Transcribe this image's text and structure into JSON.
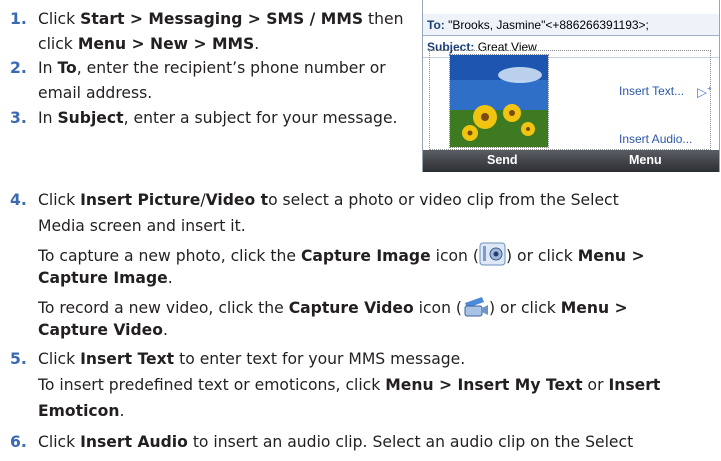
{
  "steps": [
    {
      "num": "1.",
      "lines": [
        [
          [
            "Click ",
            false
          ],
          [
            "Start > Messaging > SMS / MMS",
            true
          ],
          [
            " then",
            false
          ]
        ],
        [
          [
            "click ",
            false
          ],
          [
            "Menu > New > MMS",
            true
          ],
          [
            ".",
            false
          ]
        ]
      ]
    },
    {
      "num": "2.",
      "lines": [
        [
          [
            "In ",
            false
          ],
          [
            "To",
            true
          ],
          [
            ", enter the recipient’s phone number or",
            false
          ]
        ],
        [
          [
            "email address.",
            false
          ]
        ]
      ]
    },
    {
      "num": "3.",
      "lines": [
        [
          [
            "In ",
            false
          ],
          [
            "Subject",
            true
          ],
          [
            ", enter a subject for your message.",
            false
          ]
        ]
      ]
    },
    {
      "num": "4.",
      "lines": [
        [
          [
            "Click ",
            false
          ],
          [
            "Insert Picture",
            true
          ],
          [
            "/",
            false
          ],
          [
            "Video t",
            true
          ],
          [
            "o select a photo or video clip from the Select",
            false
          ]
        ],
        [
          [
            "Media screen and insert it.",
            false
          ]
        ],
        [
          [
            "To capture a new photo, click the ",
            false
          ],
          [
            "Capture Image",
            true
          ],
          [
            " icon (",
            false
          ],
          [
            "@camera",
            false
          ],
          [
            ") or click ",
            false
          ],
          [
            "Menu >",
            true
          ]
        ],
        [
          [
            "Capture Image",
            true
          ],
          [
            ".",
            false
          ]
        ],
        [
          [
            "To record a new video, click the ",
            false
          ],
          [
            "Capture Video",
            true
          ],
          [
            " icon (",
            false
          ],
          [
            "@video",
            false
          ],
          [
            ") or click ",
            false
          ],
          [
            "Menu >",
            true
          ]
        ],
        [
          [
            "Capture Video",
            true
          ],
          [
            ".",
            false
          ]
        ]
      ]
    },
    {
      "num": "5.",
      "lines": [
        [
          [
            "Click ",
            false
          ],
          [
            "Insert Text",
            true
          ],
          [
            " to enter text for your MMS message.",
            false
          ]
        ],
        [
          [
            "To insert predefined text or emoticons, click ",
            false
          ],
          [
            "Menu > Insert My Text",
            true
          ],
          [
            " or ",
            false
          ],
          [
            "Insert",
            true
          ]
        ],
        [
          [
            "Emoticon",
            true
          ],
          [
            ".",
            false
          ]
        ]
      ]
    },
    {
      "num": "6.",
      "lines": [
        [
          [
            "Click ",
            false
          ],
          [
            "Insert Audio",
            true
          ],
          [
            " to insert an audio clip. Select an audio clip on the Select",
            false
          ]
        ]
      ]
    }
  ],
  "phone": {
    "to_label": "To:",
    "to_value": "\"Brooks, Jasmine\"<+886266391193>;",
    "subject_label": "Subject:",
    "subject_value": "Great View",
    "insert_text": "Insert Text...",
    "insert_audio": "Insert Audio...",
    "soft_left": "Send",
    "soft_right": "Menu"
  }
}
